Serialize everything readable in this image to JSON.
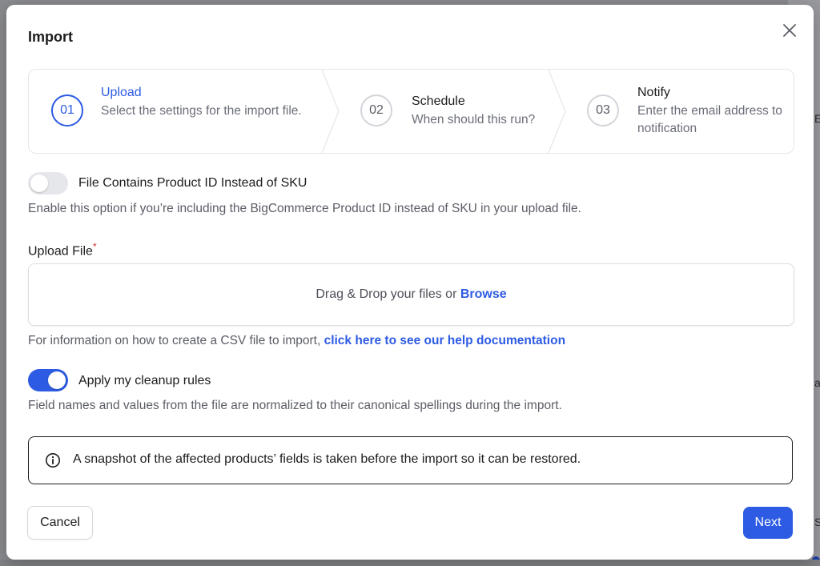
{
  "modal": {
    "title": "Import"
  },
  "stepper": {
    "steps": [
      {
        "number": "01",
        "title": "Upload",
        "description": "Select the settings for the import file.",
        "active": true
      },
      {
        "number": "02",
        "title": "Schedule",
        "description": "When should this run?",
        "active": false
      },
      {
        "number": "03",
        "title": "Notify",
        "description": "Enter the email address to notification",
        "active": false
      }
    ]
  },
  "product_id_option": {
    "label": "File Contains Product ID Instead of SKU",
    "help": "Enable this option if you’re including the BigCommerce Product ID instead of SKU in your upload file.",
    "enabled": false
  },
  "upload": {
    "label": "Upload File",
    "required_mark": "*",
    "drop_text": "Drag & Drop your files or ",
    "browse_label": "Browse"
  },
  "csv_help": {
    "text": "For information on how to create a CSV file to import, ",
    "link_label": "click here to see our help documentation"
  },
  "cleanup_option": {
    "label": "Apply my cleanup rules",
    "help": "Field names and values from the file are normalized to their canonical spellings during the import.",
    "enabled": true
  },
  "info": {
    "icon": "info-icon",
    "text": "A snapshot of the affected products’ fields is taken before the import so it can be restored."
  },
  "footer": {
    "cancel_label": "Cancel",
    "next_label": "Next"
  },
  "background": {
    "letters": [
      "E",
      "a",
      "S"
    ]
  },
  "colors": {
    "accent": "#2d5be3",
    "required": "#d12f2f"
  }
}
